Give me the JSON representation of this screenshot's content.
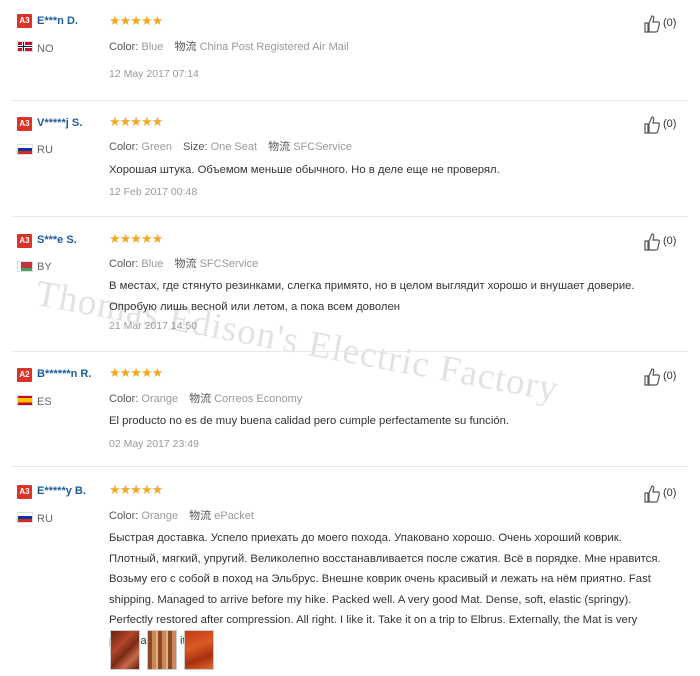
{
  "reviews": [
    {
      "badge": "A3",
      "name": "E***n D.",
      "country": "NO",
      "stars": "★★★★★",
      "color_label": "Color:",
      "color": "Blue",
      "shipping_label": "物流",
      "shipping": "China Post Registered Air Mail",
      "date": "12 May 2017 07:14",
      "likes": "(0)"
    },
    {
      "badge": "A3",
      "name": "V*****j S.",
      "country": "RU",
      "stars": "★★★★★",
      "color_label": "Color:",
      "color": "Green",
      "size_label": "Size:",
      "size": "One Seat",
      "shipping_label": "物流",
      "shipping": "SFCService",
      "text": "Хорошая штука. Объемом меньше обычного. Но в деле еще не проверял.",
      "date": "12 Feb 2017 00:48",
      "likes": "(0)"
    },
    {
      "badge": "A3",
      "name": "S***e S.",
      "country": "BY",
      "stars": "★★★★★",
      "color_label": "Color:",
      "color": "Blue",
      "shipping_label": "物流",
      "shipping": "SFCService",
      "text": "В местах, где стянуто резинками, слегка примято, но в целом выглядит хорошо и внушает доверие. Опробую лишь весной или летом, а пока всем доволен",
      "date": "21 Mar 2017 14:50",
      "likes": "(0)"
    },
    {
      "badge": "A2",
      "name": "B******n R.",
      "country": "ES",
      "stars": "★★★★★",
      "color_label": "Color:",
      "color": "Orange",
      "shipping_label": "物流",
      "shipping": "Correos Economy",
      "text": "El producto no es de muy buena calidad pero cumple perfectamente su función.",
      "date": "02 May 2017 23:49",
      "likes": "(0)"
    },
    {
      "badge": "A3",
      "name": "E*****y B.",
      "country": "RU",
      "stars": "★★★★★",
      "color_label": "Color:",
      "color": "Orange",
      "shipping_label": "物流",
      "shipping": "ePacket",
      "text": "Быстрая доставка. Успело приехать до моего похода. Упаковано хорошо. Очень хороший коврик. Плотный, мягкий, упругий. Великолепно восстанавливается после сжатия. Всё в порядке. Мне нравится. Возьму его с собой в поход на Эльбрус. Внешне коврик очень красивый и лежать на нём приятно. Fast shipping. Managed to arrive before my hike. Packed well. A very good Mat. Dense, soft, elastic (springy). Perfectly restored after compression. All right. I like it. Take it on a trip to Elbrus. Externally, the Mat is very pretty and lay it nice.",
      "likes": "(0)"
    }
  ],
  "watermark": "Thomas Edison's Electric Factory",
  "colors": {
    "badge": "#d9332a",
    "name": "#1a5c9e",
    "stars": "#f5a623"
  }
}
